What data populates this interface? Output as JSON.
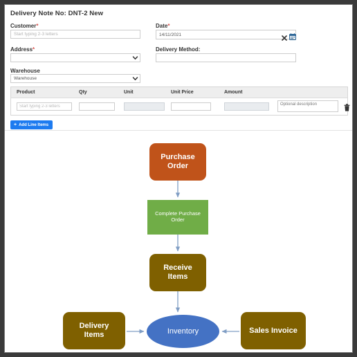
{
  "window": {
    "title": "Delivery Note No: DNT-2 New"
  },
  "form": {
    "customer": {
      "label": "Customer",
      "required_mark": "*",
      "value": "",
      "placeholder": "Start typing 2-3 letters"
    },
    "date": {
      "label": "Date",
      "required_mark": "*",
      "value": "14/11/2021",
      "clear_icon": "close-icon",
      "calendar_icon": "calendar-icon"
    },
    "address": {
      "label": "Address",
      "required_mark": "*",
      "value": "",
      "caret_icon": "chevron-down-icon"
    },
    "delivery_method": {
      "label": "Delivery Method:",
      "value": "",
      "placeholder": ""
    },
    "warehouse": {
      "label": "Warehouse",
      "value": "Warehouse",
      "caret_icon": "chevron-down-icon"
    }
  },
  "line_items": {
    "columns": [
      "Product",
      "Qty",
      "Unit",
      "Unit Price",
      "Amount"
    ],
    "rows": [
      {
        "product": "",
        "product_placeholder": "Start typing 2-3 letters",
        "qty": "",
        "unit": "",
        "unit_price": "",
        "amount": "",
        "description": "",
        "description_placeholder": "Optional description",
        "delete_icon": "trash-icon"
      }
    ],
    "add_button": {
      "label": "Add Line Items",
      "plus_icon": "+",
      "color": "#1d7bf0"
    }
  },
  "flowchart": {
    "nodes": [
      {
        "id": "purchase-order",
        "label_line1": "Purchase",
        "label_line2": "Order",
        "color": "#C0531A",
        "shape": "rounded-rect"
      },
      {
        "id": "complete-po",
        "label_line1": "Complete Purchase",
        "label_line2": "Order",
        "color": "#70AD47",
        "shape": "rect"
      },
      {
        "id": "receive-items",
        "label_line1": "Receive",
        "label_line2": "Items",
        "color": "#7F6000",
        "shape": "rounded-rect"
      },
      {
        "id": "delivery-items",
        "label_line1": "Delivery",
        "label_line2": "Items",
        "color": "#7F6000",
        "shape": "rounded-rect"
      },
      {
        "id": "inventory",
        "label_line1": "Inventory",
        "label_line2": "",
        "color": "#4472C4",
        "shape": "ellipse"
      },
      {
        "id": "sales-invoice",
        "label_line1": "Sales Invoice",
        "label_line2": "",
        "color": "#7F6000",
        "shape": "rounded-rect"
      }
    ],
    "arrow_color": "#7F9DC4"
  }
}
